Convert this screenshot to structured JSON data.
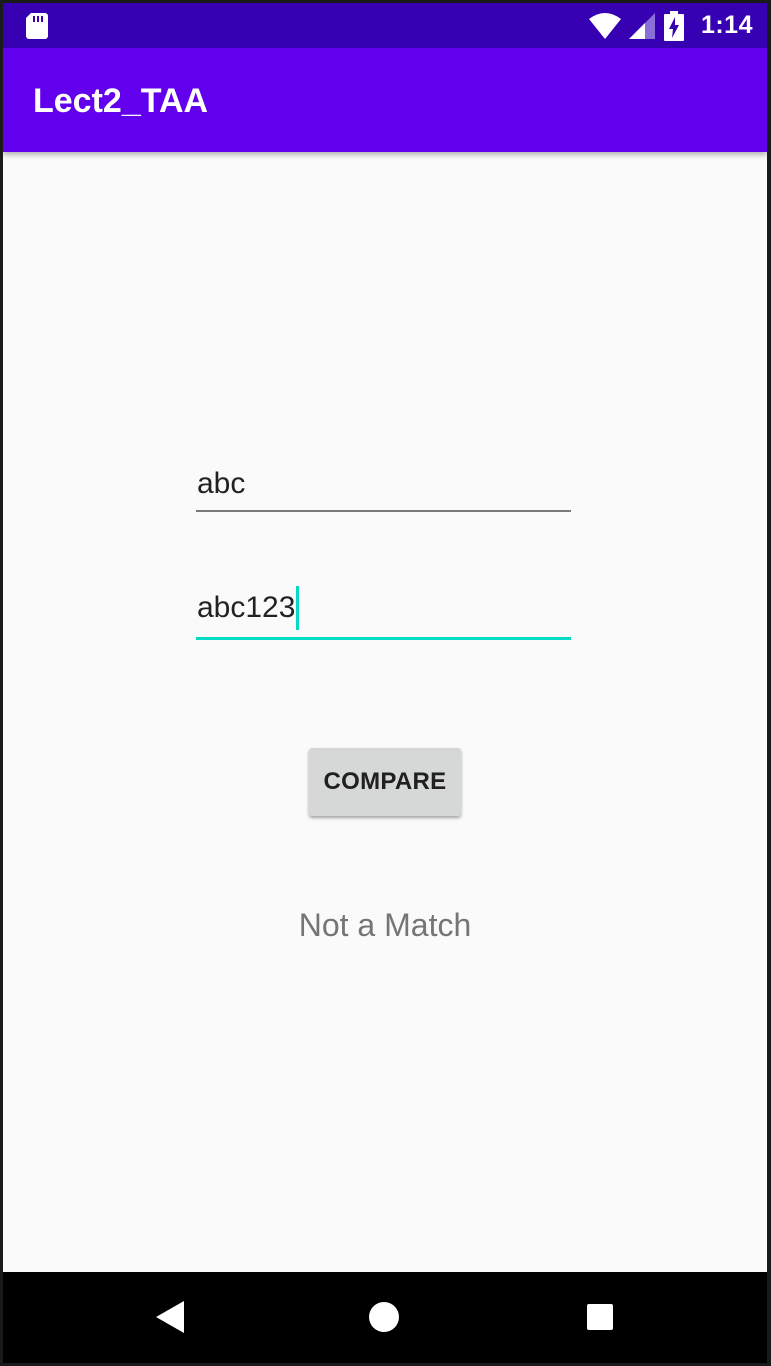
{
  "status_bar": {
    "time": "1:14",
    "icons": [
      "sd-card-icon",
      "wifi-icon",
      "cell-signal-icon",
      "battery-charging-icon"
    ],
    "background": "#3700b3"
  },
  "app_bar": {
    "title": "Lect2_TAA",
    "background": "#6200ee"
  },
  "form": {
    "first_input_value": "abc",
    "second_input_value": "abc123",
    "accent": "#03dac5",
    "compare_label": "COMPARE",
    "result_text": "Not a Match"
  },
  "nav_bar": {
    "icons": [
      "back-icon",
      "home-icon",
      "recents-icon"
    ]
  }
}
